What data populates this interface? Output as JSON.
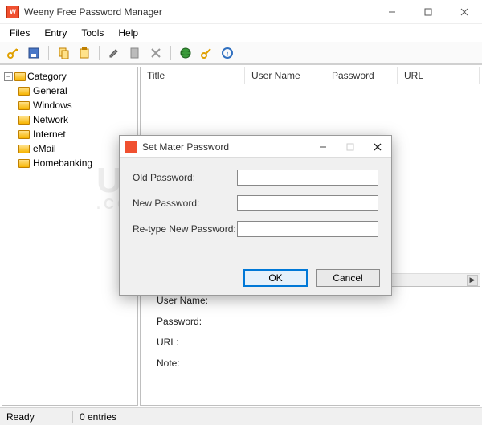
{
  "window": {
    "title": "Weeny Free Password Manager"
  },
  "menu": {
    "files": "Files",
    "entry": "Entry",
    "tools": "Tools",
    "help": "Help"
  },
  "tree": {
    "root": "Category",
    "items": [
      "General",
      "Windows",
      "Network",
      "Internet",
      "eMail",
      "Homebanking"
    ]
  },
  "columns": {
    "title": "Title",
    "username": "User Name",
    "password": "Password",
    "url": "URL"
  },
  "detail": {
    "username_label": "User Name:",
    "password_label": "Password:",
    "url_label": "URL:",
    "note_label": "Note:"
  },
  "status": {
    "ready": "Ready",
    "entries": "0 entries"
  },
  "dialog": {
    "title": "Set Mater Password",
    "old_label": "Old Password:",
    "new_label": "New Password:",
    "retype_label": "Re-type New Password:",
    "old_value": "",
    "new_value": "",
    "retype_value": "",
    "ok": "OK",
    "cancel": "Cancel"
  },
  "toolbar_icons": [
    "key-icon",
    "save-icon",
    "copy-icon",
    "paste-icon",
    "edit-icon",
    "page-icon",
    "delete-icon",
    "globe-icon",
    "key2-icon",
    "info-icon"
  ],
  "watermark": {
    "big": "UEBUG",
    "small": ".COM"
  }
}
